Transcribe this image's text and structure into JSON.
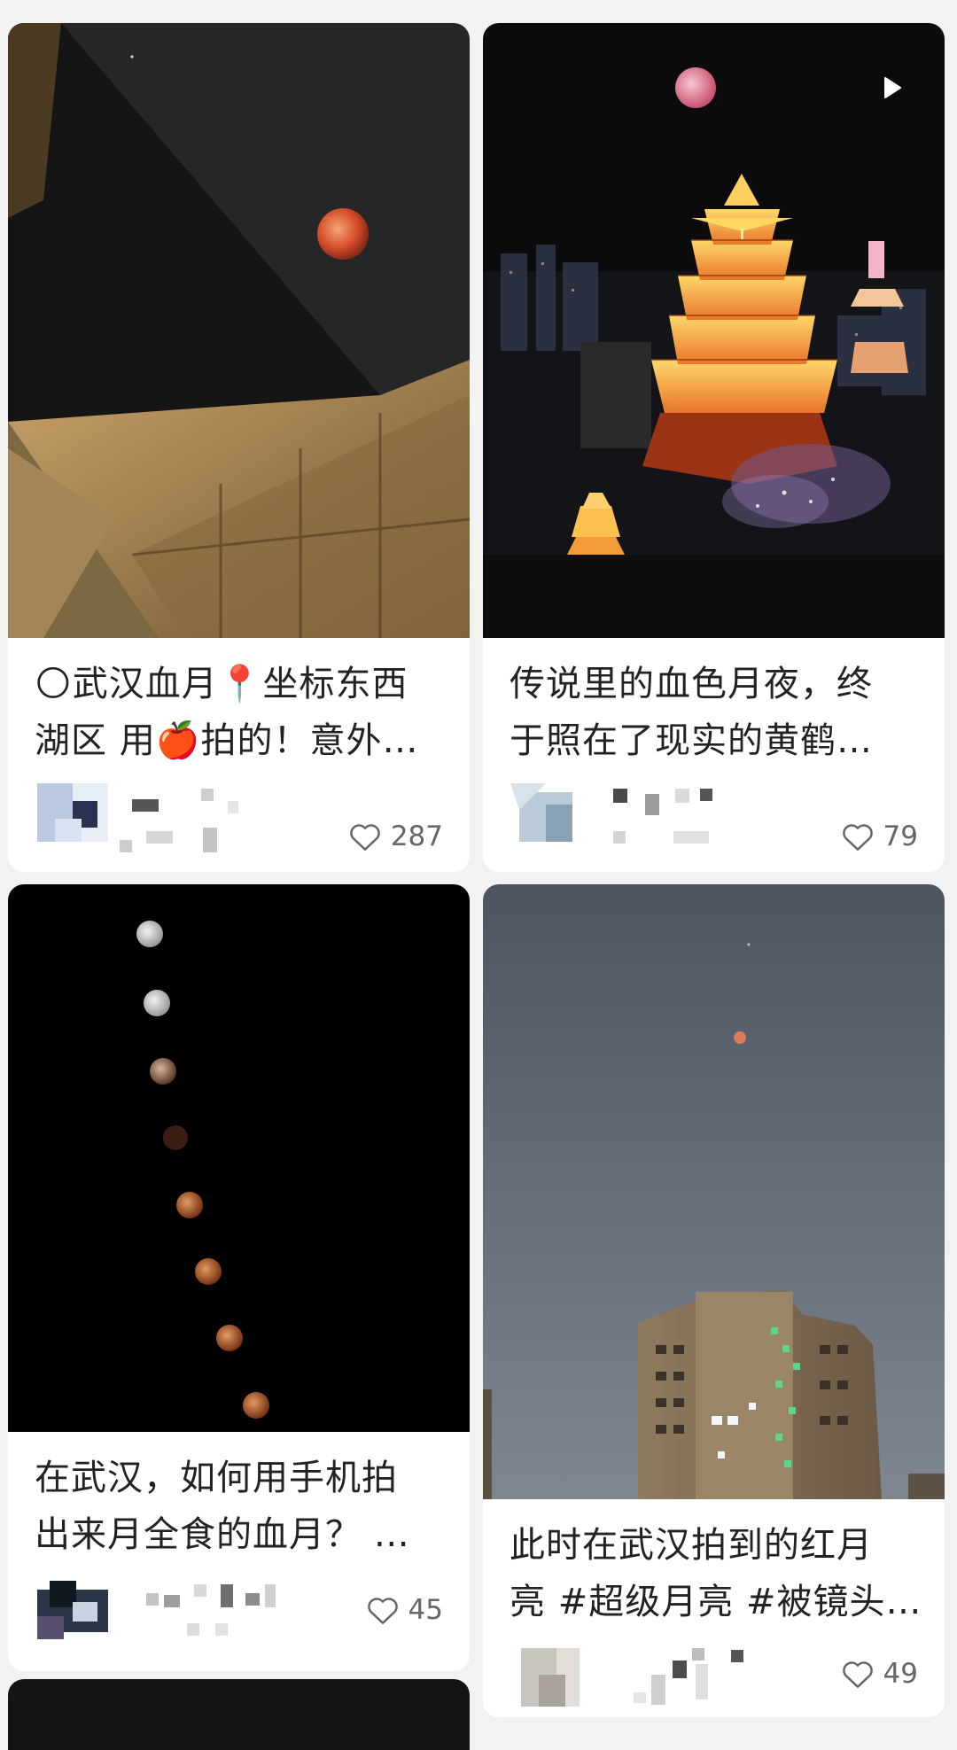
{
  "posts": [
    {
      "title_line1": "🌕武汉血月📍坐标东西",
      "title_line2": "湖区 用🍎拍的！意外…",
      "likes": "287",
      "image": "blood-moon-over-building"
    },
    {
      "title_line1": "传说里的血色月夜，终",
      "title_line2": "于照在了现实的黄鹤…",
      "likes": "79",
      "image": "yellow-crane-tower-night",
      "video_icon": "play-icon"
    },
    {
      "title_line1": "在武汉，如何用手机拍",
      "title_line2": "出来月全食的血月？ …",
      "likes": "45",
      "image": "lunar-eclipse-sequence"
    },
    {
      "title_line1": "此时在武汉拍到的红月",
      "title_line2": "亮 #超级月亮 #被镜头…",
      "likes": "49",
      "image": "red-moon-over-apartment"
    }
  ],
  "icons": {
    "like": "heart-outline-icon",
    "video": "play-icon"
  },
  "colors": {
    "background": "#f2f2f2",
    "card": "#ffffff",
    "text": "#222222",
    "meta": "#666666"
  }
}
